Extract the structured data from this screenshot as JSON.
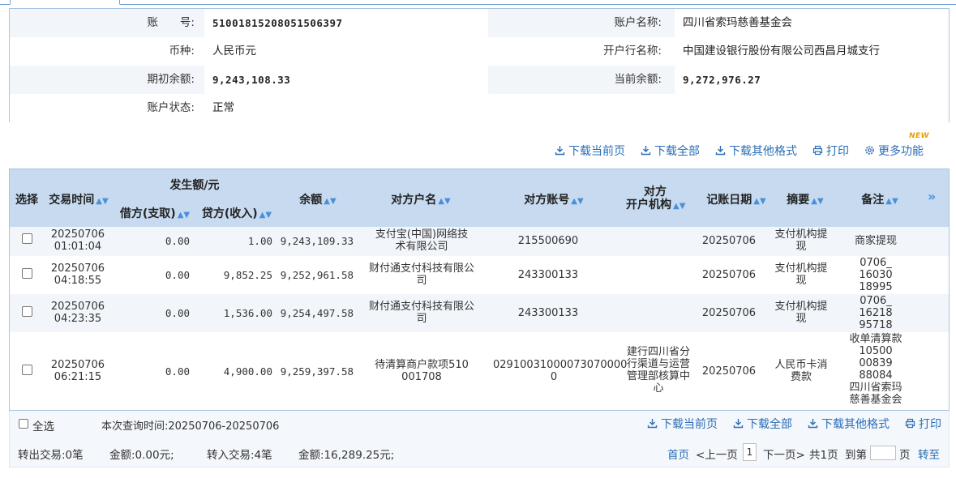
{
  "account": {
    "acct_no_label": "账　　号:",
    "acct_no": "5100181520805150639​7",
    "acct_name_label": "账户名称:",
    "acct_name": "四川省索玛慈善基金会",
    "currency_label": "币种:",
    "currency": "人民币元",
    "bank_label": "开户行名称:",
    "bank": "中国建设银行股份有限公司西昌月城支行",
    "opening_label": "期初余额:",
    "opening": "9,243,108.33",
    "current_label": "当前余额:",
    "current": "9,272,976.27",
    "status_label": "账户状态:",
    "status": "正常"
  },
  "toolbar": {
    "download_page": "下载当前页",
    "download_all": "下载全部",
    "download_other": "下载其他格式",
    "print": "打印",
    "more": "更多功能",
    "new_badge": "NEW"
  },
  "table": {
    "headers": {
      "select": "选择",
      "time": "交易时间",
      "amount_group": "发生额/元",
      "debit": "借方(支取)",
      "credit": "贷方(收入)",
      "balance": "余额",
      "cp_name": "对方户名",
      "cp_acct": "对方账号",
      "cp_bank_1": "对方",
      "cp_bank_2": "开户机构",
      "book_date": "记账日期",
      "summary": "摘要",
      "remark": "备注",
      "more": "»"
    },
    "rows": [
      {
        "time_1": "20250706",
        "time_2": "01:01:04",
        "debit": "0.00",
        "credit": "1.00",
        "balance": "9,243,109.33",
        "cp_name_1": "支付宝(中国)网络技",
        "cp_name_2": "术有限公司",
        "cp_acct": "215500690",
        "cp_bank": "",
        "book_date": "20250706",
        "summary_1": "支付机构提",
        "summary_2": "现",
        "remark": "商家提现"
      },
      {
        "time_1": "20250706",
        "time_2": "04:18:55",
        "debit": "0.00",
        "credit": "9,852.25",
        "balance": "9,252,961.58",
        "cp_name_1": "财付通支付科技有限公",
        "cp_name_2": "司",
        "cp_acct": "243300133",
        "cp_bank": "",
        "book_date": "20250706",
        "summary_1": "支付机构提",
        "summary_2": "现",
        "remark_1": "0706_",
        "remark_2": "16030",
        "remark_3": "18995"
      },
      {
        "time_1": "20250706",
        "time_2": "04:23:35",
        "debit": "0.00",
        "credit": "1,536.00",
        "balance": "9,254,497.58",
        "cp_name_1": "财付通支付科技有限公",
        "cp_name_2": "司",
        "cp_acct": "243300133",
        "cp_bank": "",
        "book_date": "20250706",
        "summary_1": "支付机构提",
        "summary_2": "现",
        "remark_1": "0706_",
        "remark_2": "16218",
        "remark_3": "95718"
      },
      {
        "time_1": "20250706",
        "time_2": "06:21:15",
        "debit": "0.00",
        "credit": "4,900.00",
        "balance": "9,259,397.58",
        "cp_name_1": "待清算商户款项510",
        "cp_name_2": "001708",
        "cp_acct_1": "02910031000073070000",
        "cp_acct_2": "0",
        "cp_bank_1": "建行四川省分",
        "cp_bank_2": "行渠道与运营",
        "cp_bank_3": "管理部核算中",
        "cp_bank_4": "心",
        "book_date": "20250706",
        "summary_1": "人民币卡消",
        "summary_2": "费款",
        "remark_1": "收单清算款",
        "remark_2": "10500",
        "remark_3": "00839",
        "remark_4": "88084",
        "remark_5": "四川省索玛",
        "remark_6": "慈善基金会"
      }
    ]
  },
  "footer": {
    "select_all": "全选",
    "query_time": "本次查询时间:20250706-20250706",
    "download_page": "下载当前页",
    "download_all": "下载全部",
    "download_other": "下载其他格式",
    "print": "打印",
    "out_count": "转出交易:0笔",
    "out_amount": "金额:0.00元;",
    "in_count": "转入交易:4笔",
    "in_amount": "金额:16,289.25元;",
    "first": "首页",
    "prev": "<上一页",
    "page": "1",
    "next": "下一页>",
    "total": "共1页",
    "goto_label": "到第",
    "page_unit": "页",
    "goto_btn": "转至"
  },
  "colors": {
    "link": "#2a6eb5",
    "header_bg": "#c7daf0",
    "border": "#a7c4e2",
    "badge": "#e8a000"
  }
}
